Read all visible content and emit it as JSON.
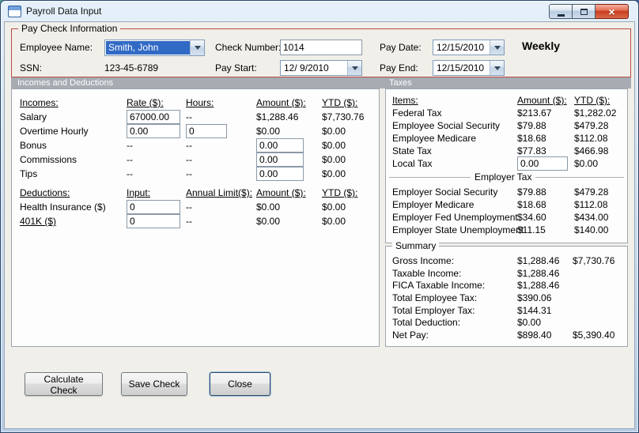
{
  "window": {
    "title": "Payroll Data Input"
  },
  "icons": {
    "close_glyph": "×"
  },
  "colors": {
    "group_box_border": "#BA4A44",
    "selection_bg": "#316AC5",
    "section_header_bg": "#A6ACB2",
    "close_button_red": "#C83B1D"
  },
  "paycheck": {
    "group_label": "Pay Check Information",
    "employee_name": {
      "label": "Employee Name:",
      "value": "Smith, John"
    },
    "ssn": {
      "label": "SSN:",
      "value": "123-45-6789"
    },
    "check_number": {
      "label": "Check Number:",
      "value": "1014"
    },
    "pay_start": {
      "label": "Pay Start:",
      "value": "12/ 9/2010"
    },
    "pay_date": {
      "label": "Pay Date:",
      "value": "12/15/2010"
    },
    "pay_end": {
      "label": "Pay End:",
      "value": "12/15/2010"
    },
    "frequency": "Weekly"
  },
  "section_headers": {
    "left": "Incomes and Deductions",
    "right": "Taxes"
  },
  "incomes": {
    "headers": {
      "col0": "Incomes:",
      "col1": "Rate ($):",
      "col2": "Hours:",
      "col3": "Amount ($):",
      "col4": "YTD ($):"
    },
    "rows": [
      {
        "label": "Salary",
        "rate": "67000.00",
        "hours": "--",
        "amount": "$1,288.46",
        "ytd": "$7,730.76"
      },
      {
        "label": "Overtime Hourly",
        "rate": "0.00",
        "hours": "0",
        "amount": "$0.00",
        "ytd": "$0.00"
      },
      {
        "label": "Bonus",
        "rate": "--",
        "hours": "--",
        "amount": "0.00",
        "ytd": "$0.00"
      },
      {
        "label": "Commissions",
        "rate": "--",
        "hours": "--",
        "amount": "0.00",
        "ytd": "$0.00"
      },
      {
        "label": "Tips",
        "rate": "--",
        "hours": "--",
        "amount": "0.00",
        "ytd": "$0.00"
      }
    ]
  },
  "deductions": {
    "headers": {
      "col0": "Deductions:",
      "col1": "Input:",
      "col2": "Annual Limit($):",
      "col3": "Amount ($):",
      "col4": "YTD ($):"
    },
    "rows": [
      {
        "label": "Health Insurance  ($)",
        "input": "0",
        "limit": "--",
        "amount": "$0.00",
        "ytd": "$0.00"
      },
      {
        "label": "401K  ($)",
        "input": "0",
        "limit": "--",
        "amount": "$0.00",
        "ytd": "$0.00"
      }
    ]
  },
  "taxes": {
    "headers": {
      "col0": "Items:",
      "col1": "Amount ($):",
      "col2": "YTD ($):"
    },
    "rows": [
      {
        "label": "Federal Tax",
        "amount": "$213.67",
        "ytd": "$1,282.02"
      },
      {
        "label": "Employee Social Security",
        "amount": "$79.88",
        "ytd": "$479.28"
      },
      {
        "label": "Employee Medicare",
        "amount": "$18.68",
        "ytd": "$112.08"
      },
      {
        "label": "State Tax",
        "amount": "$77.83",
        "ytd": "$466.98"
      }
    ],
    "local_tax": {
      "label": "Local Tax",
      "amount": "0.00",
      "ytd": "$0.00"
    },
    "employer_header": "Employer Tax",
    "employer_rows": [
      {
        "label": "Employer Social Security",
        "amount": "$79.88",
        "ytd": "$479.28"
      },
      {
        "label": "Employer Medicare",
        "amount": "$18.68",
        "ytd": "$112.08"
      },
      {
        "label": "Employer Fed Unemployment",
        "amount": "$34.60",
        "ytd": "$434.00"
      },
      {
        "label": "Employer State Unemployment",
        "amount": "$11.15",
        "ytd": "$140.00"
      }
    ]
  },
  "summary": {
    "group_label": "Summary",
    "rows": [
      {
        "label": "Gross Income:",
        "amount": "$1,288.46",
        "ytd": "$7,730.76"
      },
      {
        "label": "Taxable Income:",
        "amount": "$1,288.46",
        "ytd": ""
      },
      {
        "label": "FICA Taxable Income:",
        "amount": "$1,288.46",
        "ytd": ""
      },
      {
        "label": "Total Employee Tax:",
        "amount": "$390.06",
        "ytd": ""
      },
      {
        "label": "Total Employer Tax:",
        "amount": "$144.31",
        "ytd": ""
      },
      {
        "label": "Total Deduction:",
        "amount": "$0.00",
        "ytd": ""
      },
      {
        "label": "Net Pay:",
        "amount": "$898.40",
        "ytd": "$5,390.40"
      }
    ]
  },
  "buttons": {
    "calculate": "Calculate Check",
    "save": "Save Check",
    "close": "Close"
  }
}
